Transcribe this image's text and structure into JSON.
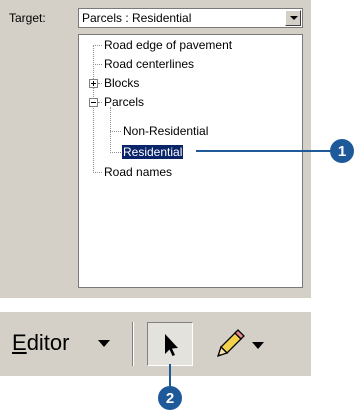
{
  "target": {
    "label": "Target:",
    "selected_value": "Parcels : Residential"
  },
  "tree": {
    "items": [
      {
        "label": "Road  edge of pavement"
      },
      {
        "label": "Road centerlines"
      },
      {
        "label": "Blocks",
        "expander": "plus"
      },
      {
        "label": "Parcels",
        "expander": "minus"
      },
      {
        "label": "Non-Residential"
      },
      {
        "label": "Residential",
        "selected": true
      },
      {
        "label": "Road names"
      }
    ]
  },
  "editor_toolbar": {
    "editor_menu_label": "Editor",
    "editor_menu_mnemonic": "E",
    "editor_menu_rest": "ditor",
    "pointer_tool_icon": "arrow-pointer-icon",
    "sketch_tool_icon": "pencil-icon"
  },
  "callouts": {
    "one": "1",
    "two": "2"
  },
  "colors": {
    "panel_bg": "#d4d0c8",
    "selection_bg": "#0a246a",
    "callout": "#1e5a9a"
  }
}
